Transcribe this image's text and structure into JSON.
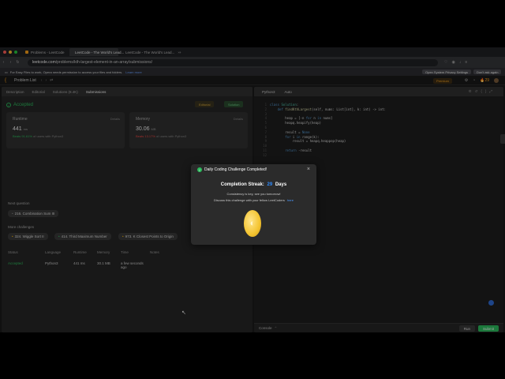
{
  "browser": {
    "tabs": [
      {
        "label": "Problems - LeetCode"
      },
      {
        "label": "LeetCode - The World's Lead..."
      },
      {
        "label": "LeetCode - The World's Lead..."
      }
    ],
    "url_prefix": "",
    "url_host": "leetcode.com",
    "url_path": "/problems/kth-largest-element-in-an-array/submissions/",
    "infobar_text": "For Easy Files to work, Opera needs permission to access your files and folders.",
    "infobar_link": "Learn more",
    "infobar_btn_settings": "Open System Privacy Settings",
    "infobar_btn_dismiss": "Don't ask again"
  },
  "header": {
    "problem_list": "Problem List",
    "premium": "Premium",
    "streak": "29"
  },
  "left": {
    "tabs": [
      "Description",
      "Editorial",
      "Solutions (8.4K)",
      "Submissions"
    ],
    "status": "Accepted",
    "editorial_btn": "Editorial",
    "solution_btn": "Solution",
    "runtime": {
      "label": "Runtime",
      "details": "Details",
      "value": "441",
      "unit": "ms",
      "beats": "Beats 91.61%",
      "beats_suffix": "of users with Python3"
    },
    "memory": {
      "label": "Memory",
      "details": "Details",
      "value": "30.06",
      "unit": "MB",
      "beats": "Beats 13.17%",
      "beats_suffix": "of users with Python3"
    },
    "next_question_label": "Next question",
    "next_question": "216. Combination Sum III",
    "more_challenges_label": "More challenges",
    "challenges": [
      "324. Wiggle Sort II",
      "414. Third Maximum Number",
      "973. K Closest Points to Origin"
    ],
    "table": {
      "headers": [
        "Status",
        "Language",
        "Runtime",
        "Memory",
        "Time",
        "Notes"
      ],
      "rows": [
        {
          "status": "Accepted",
          "language": "Python3",
          "runtime": "441 ms",
          "memory": "30.1 MB",
          "time": "a few seconds ago",
          "notes": ""
        }
      ]
    }
  },
  "right": {
    "language": "Python3",
    "mode": "Auto",
    "console": "Console",
    "run": "Run",
    "submit": "Submit"
  },
  "modal": {
    "title": "Daily Coding Challenge Completed!",
    "streak_label": "Completion Streak:",
    "streak_value": "29",
    "streak_unit": "Days",
    "line1": "Consistency is key, see you tomorrow!",
    "line2": "Discuss this challenge with your fellow LeetCoders",
    "line2_link": "here"
  }
}
